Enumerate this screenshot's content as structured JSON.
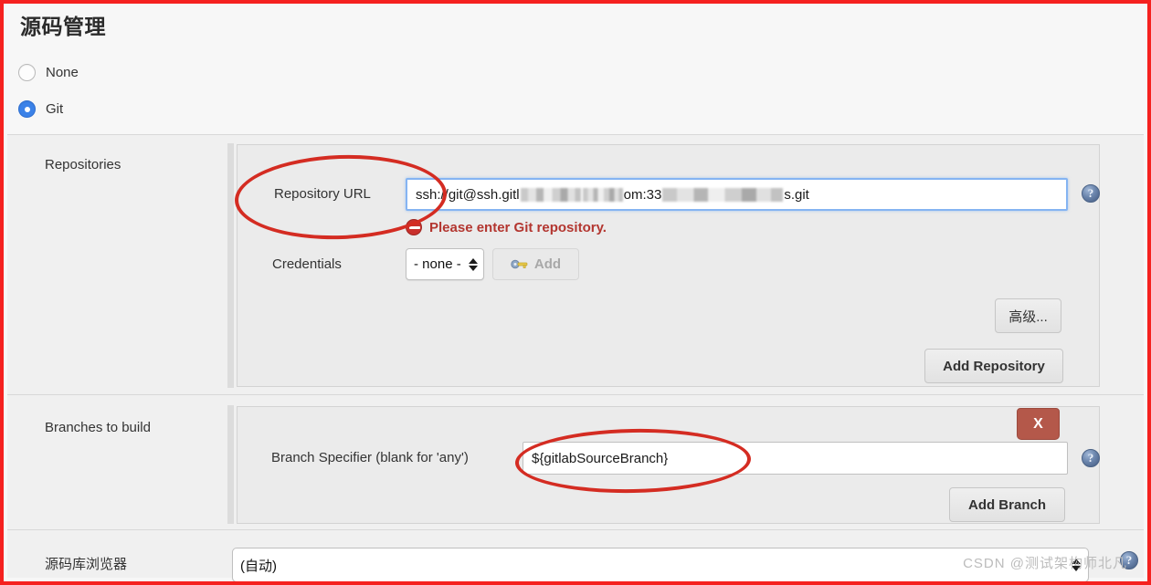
{
  "page": {
    "title": "源码管理",
    "watermark": "CSDN @测试架构师北凡"
  },
  "scm_choice": {
    "options": [
      {
        "label": "None",
        "selected": false
      },
      {
        "label": "Git",
        "selected": true
      }
    ]
  },
  "repositories": {
    "row_label": "Repositories",
    "repository_url": {
      "label": "Repository URL",
      "value_prefix": "ssh://git@ssh.gitl",
      "value_middle": "om:33",
      "value_suffix": "s.git",
      "redacted": true
    },
    "error": {
      "icon": "error-circle-icon",
      "text": "Please enter Git repository."
    },
    "credentials": {
      "label": "Credentials",
      "value": "- none -",
      "add_button": "Add",
      "add_button_disabled": true,
      "add_button_icon": "key-icon"
    },
    "advanced_button": "高级...",
    "add_repository_button": "Add Repository"
  },
  "branches": {
    "row_label": "Branches to build",
    "branch_specifier": {
      "label": "Branch Specifier (blank for 'any')",
      "value": "${gitlabSourceBranch}"
    },
    "delete_button": "X",
    "add_branch_button": "Add Branch"
  },
  "repository_browser": {
    "label": "源码库浏览器",
    "value": "(自动)"
  },
  "help_icons": {
    "glyph": "?"
  },
  "colors": {
    "accent_blue": "#3b82e8",
    "error_red": "#b33630",
    "annotation_red": "#d42c22",
    "frame_red": "#f5211f",
    "delete_button": "#b4584a"
  }
}
